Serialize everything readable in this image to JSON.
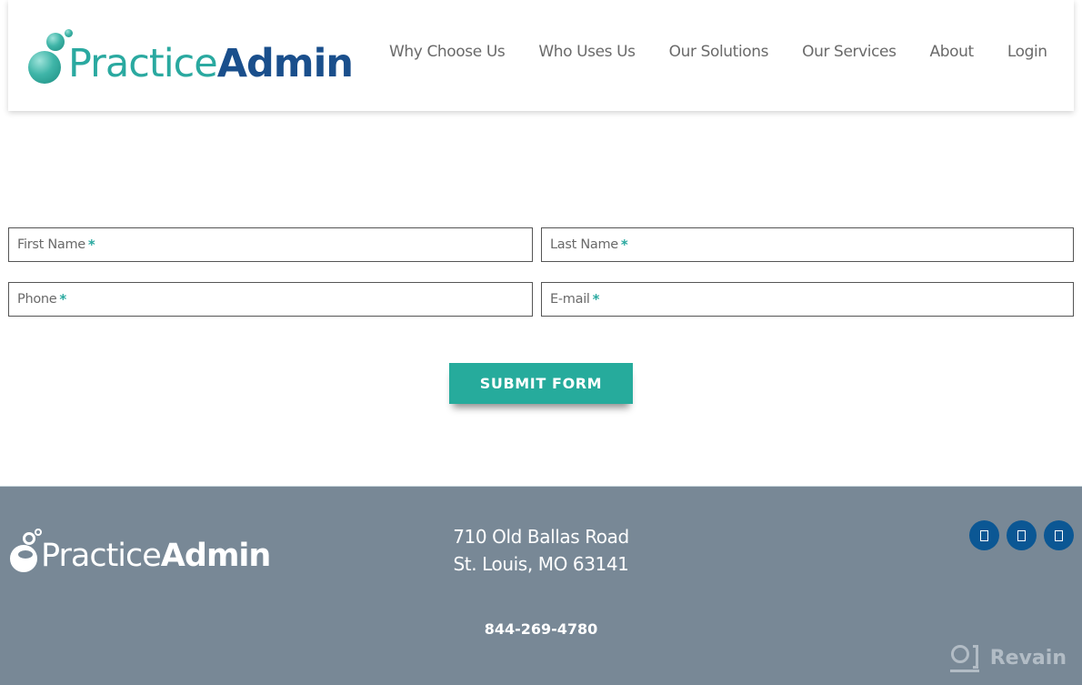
{
  "header": {
    "logo": {
      "part1": "Practice",
      "part2": "Admin"
    },
    "nav": [
      {
        "label": "Why Choose Us"
      },
      {
        "label": "Who Uses Us"
      },
      {
        "label": "Our Solutions"
      },
      {
        "label": "Our Services"
      },
      {
        "label": "About"
      },
      {
        "label": "Login"
      }
    ]
  },
  "form": {
    "fields": {
      "first_name": {
        "placeholder": "First Name",
        "required_mark": "*",
        "value": ""
      },
      "last_name": {
        "placeholder": "Last Name",
        "required_mark": "*",
        "value": ""
      },
      "phone": {
        "placeholder": "Phone",
        "required_mark": "*",
        "value": ""
      },
      "email": {
        "placeholder": "E-mail",
        "required_mark": "*",
        "value": ""
      }
    },
    "submit_label": "SUBMIT FORM"
  },
  "footer": {
    "logo": {
      "part1": "Practice",
      "part2": "Admin"
    },
    "address_line1": "710 Old Ballas Road",
    "address_line2": "St. Louis, MO 63141",
    "phone": "844-269-4780",
    "social_icons": [
      "social-icon-1",
      "social-icon-2",
      "social-icon-3"
    ],
    "watermark": "Revain"
  },
  "colors": {
    "brand_teal": "#2aa9a0",
    "brand_blue": "#1a4f8c",
    "button": "#26ab9c",
    "footer_bg": "#788896",
    "social_bg": "#0b5794"
  }
}
